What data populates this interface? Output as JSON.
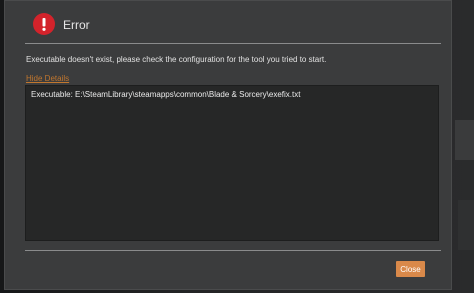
{
  "dialog": {
    "title": "Error",
    "icon": "error-exclamation-icon",
    "icon_color": "#d3232b",
    "message": "Executable doesn't exist, please check the configuration for the tool you tried to start.",
    "hide_details_label": "Hide Details",
    "details_text": "Executable: E:\\SteamLibrary\\steamapps\\common\\Blade & Sorcery\\exefix.txt",
    "close_label": "Close",
    "accent_color": "#d9894a",
    "link_color": "#c2772e"
  }
}
